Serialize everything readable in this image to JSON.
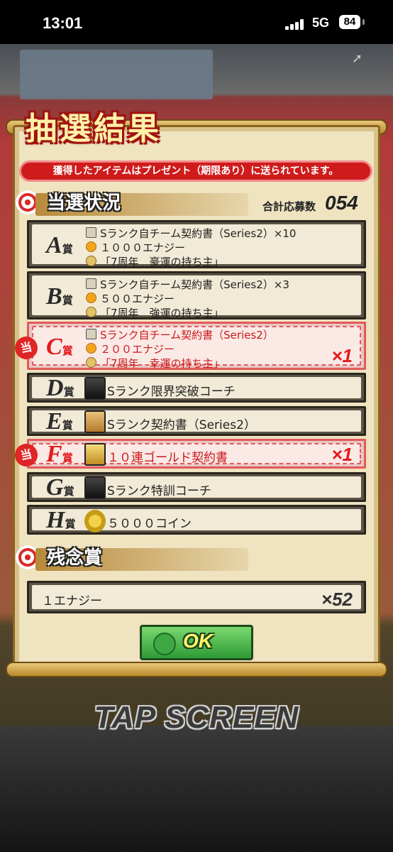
{
  "status_bar": {
    "time": "13:01",
    "network": "5G",
    "battery": "84"
  },
  "title": "抽選結果",
  "notice": "獲得したアイテムはプレゼント（期限あり）に送られています。",
  "section_winning": {
    "label": "当選状況",
    "count_label": "合計応募数",
    "count": "054"
  },
  "prizes": [
    {
      "grade": "A",
      "suffix": "賞",
      "won": false,
      "lines": [
        "Sランク自チーム契約書（Series2）×10",
        "１０００エナジー",
        "「7周年　豪運の持ち主」"
      ],
      "mult": ""
    },
    {
      "grade": "B",
      "suffix": "賞",
      "won": false,
      "lines": [
        "Sランク自チーム契約書（Series2）×3",
        "５００エナジー",
        "「7周年　強運の持ち主」"
      ],
      "mult": ""
    },
    {
      "grade": "C",
      "suffix": "賞",
      "won": true,
      "lines": [
        "Sランク自チーム契約書（Series2）",
        "２００エナジー",
        "「7周年　幸運の持ち主」"
      ],
      "mult": "×1"
    },
    {
      "grade": "D",
      "suffix": "賞",
      "won": false,
      "item": "Sランク限界突破コーチ",
      "mult": ""
    },
    {
      "grade": "E",
      "suffix": "賞",
      "won": false,
      "item": "Sランク契約書（Series2）",
      "mult": ""
    },
    {
      "grade": "F",
      "suffix": "賞",
      "won": true,
      "item": "１０連ゴールド契約書",
      "mult": "×1"
    },
    {
      "grade": "G",
      "suffix": "賞",
      "won": false,
      "item": "Sランク特訓コーチ",
      "mult": ""
    },
    {
      "grade": "H",
      "suffix": "賞",
      "won": false,
      "item": "５０００コイン",
      "mult": ""
    }
  ],
  "stamp_text": "当",
  "section_consolation": {
    "label": "残念賞"
  },
  "consolation": {
    "item": "１エナジー",
    "mult": "×52"
  },
  "ok_button": "OK",
  "tap_screen": "TAP SCREEN",
  "icons": {
    "doc": "contract-doc-icon",
    "energy": "energy-icon",
    "medal": "title-medal-icon"
  },
  "colors": {
    "won_red": "#e21b1b",
    "notice_red": "#cf1b1b",
    "ok_green": "#2e9a35",
    "panel_cream": "#efe3c0"
  }
}
